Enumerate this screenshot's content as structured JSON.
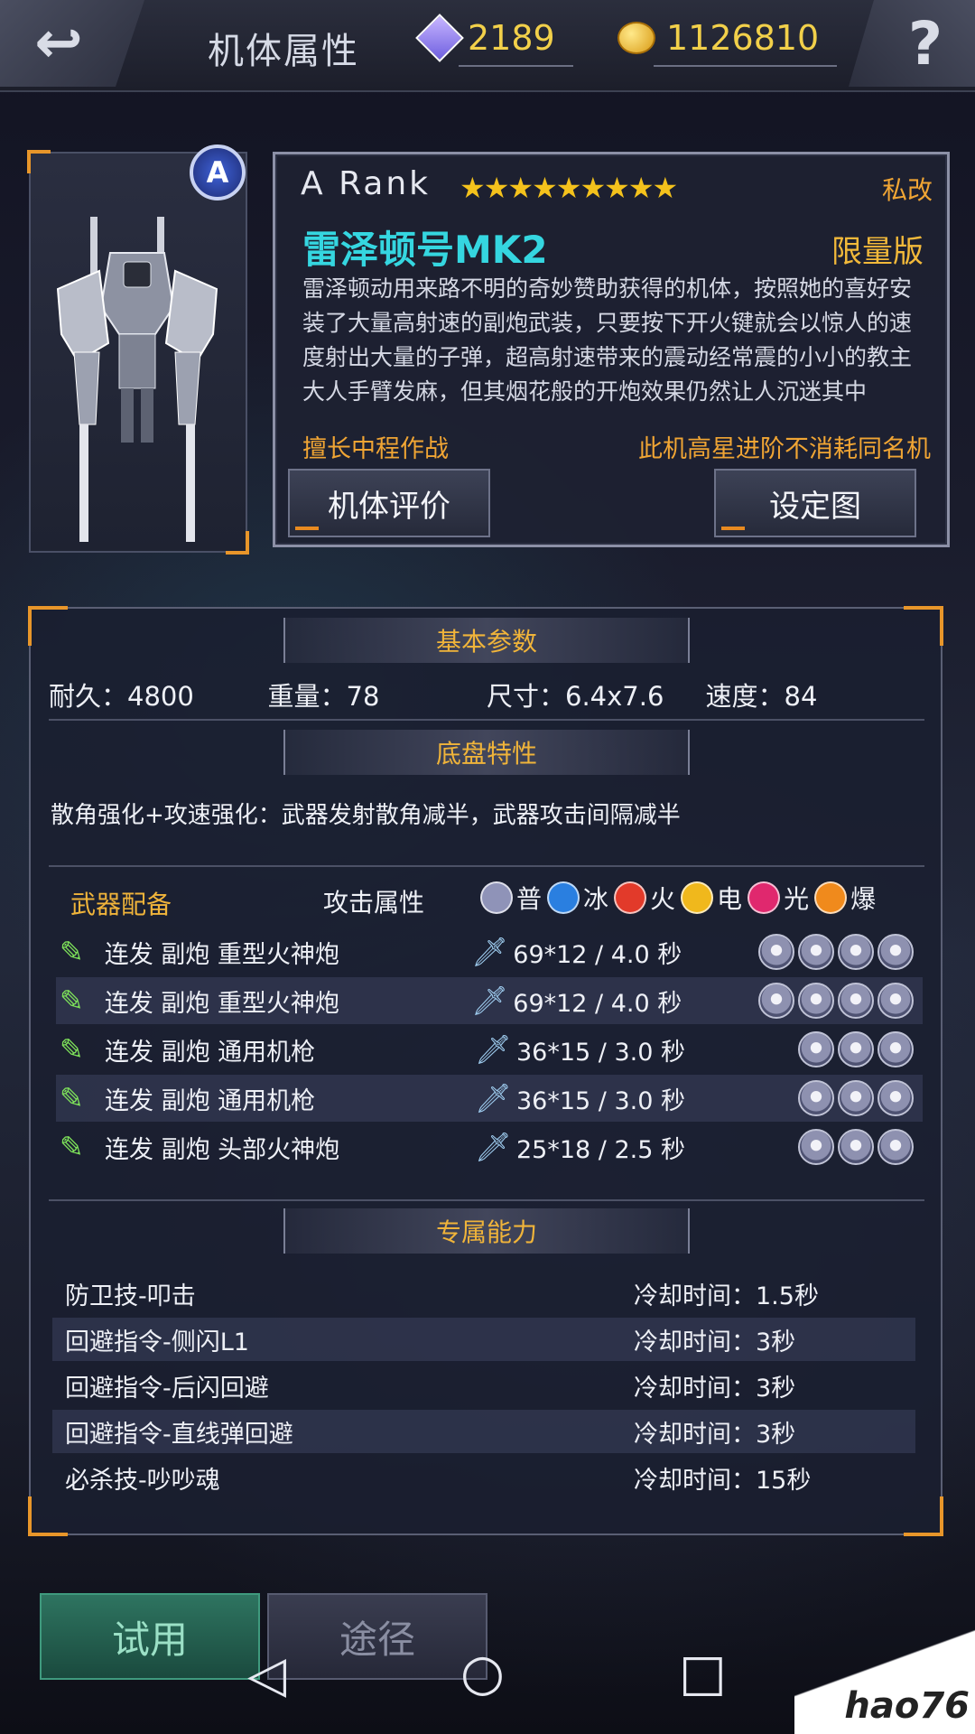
{
  "header": {
    "title": "机体属性",
    "gems": "2189",
    "coins": "1126810"
  },
  "unit": {
    "rank_badge": "A",
    "rank": "A  Rank",
    "stars": "★★★★★★★★★",
    "star_count": 9,
    "private_tag": "私改",
    "name": "雷泽顿号MK2",
    "limited": "限量版",
    "description": "雷泽顿动用来路不明的奇妙赞助获得的机体，按照她的喜好安装了大量高射速的副炮武装，只要按下开火键就会以惊人的速度射出大量的子弹，超高射速带来的震动经常震的小小的教主大人手臂发麻，但其烟花般的开炮效果仍然让人沉迷其中",
    "strength": "擅长中程作战",
    "note": "此机高星进阶不消耗同名机",
    "btn_review": "机体评价",
    "btn_design": "设定图"
  },
  "basic": {
    "heading": "基本参数",
    "durability": "耐久：4800",
    "weight": "重量：78",
    "size": "尺寸：6.4x7.6",
    "speed": "速度：84"
  },
  "chassis": {
    "heading": "底盘特性",
    "text": "散角强化+攻速强化：武器发射散角减半，武器攻击间隔减半"
  },
  "weapons": {
    "heading": "武器配备",
    "attr_heading": "攻击属性",
    "attrs": [
      {
        "label": "普",
        "color": "#8f93b8"
      },
      {
        "label": "冰",
        "color": "#2a7fe0"
      },
      {
        "label": "火",
        "color": "#e23a2a"
      },
      {
        "label": "电",
        "color": "#f0b81c"
      },
      {
        "label": "光",
        "color": "#e0286e"
      },
      {
        "label": "爆",
        "color": "#f08a1c"
      }
    ],
    "rows": [
      {
        "name": "连发 副炮  重型火神炮",
        "dmg": "69*12 / 4.0 秒",
        "slots": 4
      },
      {
        "name": "连发 副炮  重型火神炮",
        "dmg": "69*12 / 4.0 秒",
        "slots": 4
      },
      {
        "name": "连发 副炮  通用机枪",
        "dmg": "36*15 / 3.0 秒",
        "slots": 3
      },
      {
        "name": "连发 副炮  通用机枪",
        "dmg": "36*15 / 3.0 秒",
        "slots": 3
      },
      {
        "name": "连发 副炮  头部火神炮",
        "dmg": "25*18 / 2.5 秒",
        "slots": 3
      }
    ]
  },
  "skills": {
    "heading": "专属能力",
    "rows": [
      {
        "name": "防卫技-叩击",
        "cd": "冷却时间：1.5秒"
      },
      {
        "name": "回避指令-侧闪L1",
        "cd": "冷却时间：3秒"
      },
      {
        "name": "回避指令-后闪回避",
        "cd": "冷却时间：3秒"
      },
      {
        "name": "回避指令-直线弹回避",
        "cd": "冷却时间：3秒"
      },
      {
        "name": "必杀技-吵吵魂",
        "cd": "冷却时间：15秒"
      }
    ]
  },
  "bottom": {
    "try": "试用",
    "route": "途径"
  },
  "watermark": "hao76"
}
